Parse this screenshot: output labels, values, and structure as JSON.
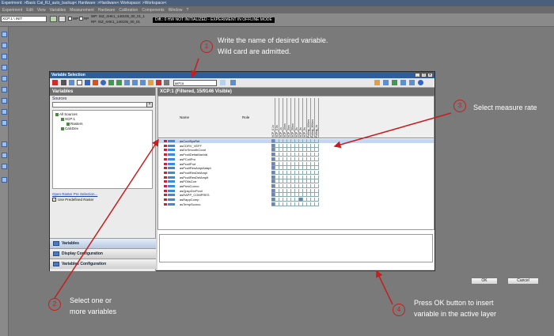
{
  "app": {
    "title": "Experiment: >Basic Cal_RJ_auto_backup< Hardware: >Hardware< Workspace: >Workspace<",
    "menu": [
      "Experiment",
      "Edit",
      "View",
      "Variables",
      "Measurement",
      "Hardware",
      "Calibration",
      "Components",
      "Window",
      "?"
    ],
    "project": "XCP:1 \\ INIT",
    "toolbar": {
      "wp_label": "WP",
      "rp_label": "RP",
      "wp_value": "WP: ISZ_4HK1_140105_00_01_1",
      "rp_value": "RP: ISZ_4HK1_140105_00_01"
    },
    "status_banner": "Diff.: 0   HW NOT INITIALIZED - EXPERIMENT IN OFFLINE MODE"
  },
  "dialog": {
    "title": "Variable Selection",
    "search_value": "as*co",
    "left_panel": {
      "header": "Variables",
      "sources_label": "Sources",
      "tree": [
        "All Sources",
        "XCP:1",
        "Rasters",
        "CalcDev"
      ],
      "open_raster_link": "Open Raster Pre Selection...",
      "predefined_raster": "Use Predefined Raster",
      "nav": [
        "Variables",
        "Display Configuration",
        "Variables Configuration"
      ]
    },
    "right_panel": {
      "header": "XCP:1 (Filtered, 15/9146 Visible)",
      "columns": {
        "name": "Name",
        "role": "Role"
      },
      "rasters": [
        "XCP_0.1s",
        "XCP_0.5s",
        "XCP_1s",
        "XCP_10ms",
        "XCP_2ms",
        "XCP_20ms",
        "XCP_2s",
        "XCP_3s",
        "XCP_5s",
        "Polling_100ms",
        "Polling_200ms",
        "Polling_1s"
      ],
      "variables": [
        {
          "name": "asCoolSysRet",
          "selected": true,
          "raster": [
            1,
            0,
            0,
            0,
            0,
            0,
            0,
            0,
            0,
            0,
            0,
            0
          ]
        },
        {
          "name": "asCDRV_VEFF",
          "selected": false,
          "raster": [
            1,
            0,
            0,
            0,
            0,
            0,
            0,
            0,
            0,
            0,
            0,
            0
          ]
        },
        {
          "name": "asErrSmoothCond",
          "selected": false,
          "raster": [
            1,
            0,
            0,
            0,
            0,
            0,
            0,
            0,
            0,
            0,
            0,
            0
          ]
        },
        {
          "name": "asPcoilDeltaMaxVal",
          "selected": false,
          "raster": [
            1,
            0,
            0,
            0,
            0,
            0,
            0,
            0,
            0,
            0,
            0,
            0
          ]
        },
        {
          "name": "asPCoilPro",
          "selected": false,
          "raster": [
            1,
            0,
            0,
            0,
            0,
            0,
            0,
            0,
            0,
            0,
            0,
            0
          ]
        },
        {
          "name": "asPcoilProf",
          "selected": false,
          "raster": [
            1,
            0,
            0,
            0,
            0,
            0,
            0,
            0,
            0,
            0,
            0,
            0
          ]
        },
        {
          "name": "asPcoilResAmplAdapt",
          "selected": false,
          "raster": [
            1,
            0,
            0,
            0,
            0,
            0,
            0,
            0,
            0,
            0,
            0,
            0
          ]
        },
        {
          "name": "asPcoilResDelAmpl",
          "selected": false,
          "raster": [
            1,
            0,
            0,
            0,
            0,
            0,
            0,
            0,
            0,
            0,
            0,
            0
          ]
        },
        {
          "name": "asPcoilResDelAmplt",
          "selected": false,
          "raster": [
            1,
            0,
            0,
            0,
            0,
            0,
            0,
            0,
            0,
            0,
            0,
            0
          ]
        },
        {
          "name": "asPOilsCorr",
          "selected": false,
          "raster": [
            1,
            0,
            0,
            0,
            0,
            0,
            0,
            0,
            0,
            0,
            0,
            0
          ]
        },
        {
          "name": "asPresCorrco",
          "selected": false,
          "raster": [
            1,
            0,
            0,
            0,
            0,
            0,
            0,
            0,
            0,
            0,
            0,
            0
          ]
        },
        {
          "name": "asQpspDrvPcoil",
          "selected": false,
          "raster": [
            1,
            0,
            0,
            0,
            0,
            0,
            0,
            0,
            0,
            0,
            0,
            0
          ]
        },
        {
          "name": "asRAPP_COMPRES",
          "selected": false,
          "raster": [
            1,
            0,
            0,
            0,
            0,
            0,
            0,
            0,
            0,
            0,
            0,
            0
          ]
        },
        {
          "name": "asRappComp",
          "selected": false,
          "raster": [
            1,
            0,
            0,
            0,
            0,
            0,
            0,
            1,
            0,
            0,
            0,
            0
          ]
        },
        {
          "name": "asTempScorco",
          "selected": false,
          "raster": [
            1,
            0,
            0,
            0,
            0,
            0,
            0,
            0,
            0,
            0,
            0,
            0
          ]
        }
      ]
    },
    "buttons": {
      "ok": "OK",
      "cancel": "Cancel"
    }
  },
  "annotations": [
    {
      "num": "1",
      "text": "Write the name of desired variable.\nWild card are admitted."
    },
    {
      "num": "2",
      "text": "Select one or\nmore variables"
    },
    {
      "num": "3",
      "text": "Select measure rate"
    },
    {
      "num": "4",
      "text": "Press OK button to insert\nvariable in the active layer"
    }
  ],
  "colors": {
    "annotation": "#c41f1f",
    "background": "#7a7a7a",
    "dialog_title": "#2f5f99"
  }
}
